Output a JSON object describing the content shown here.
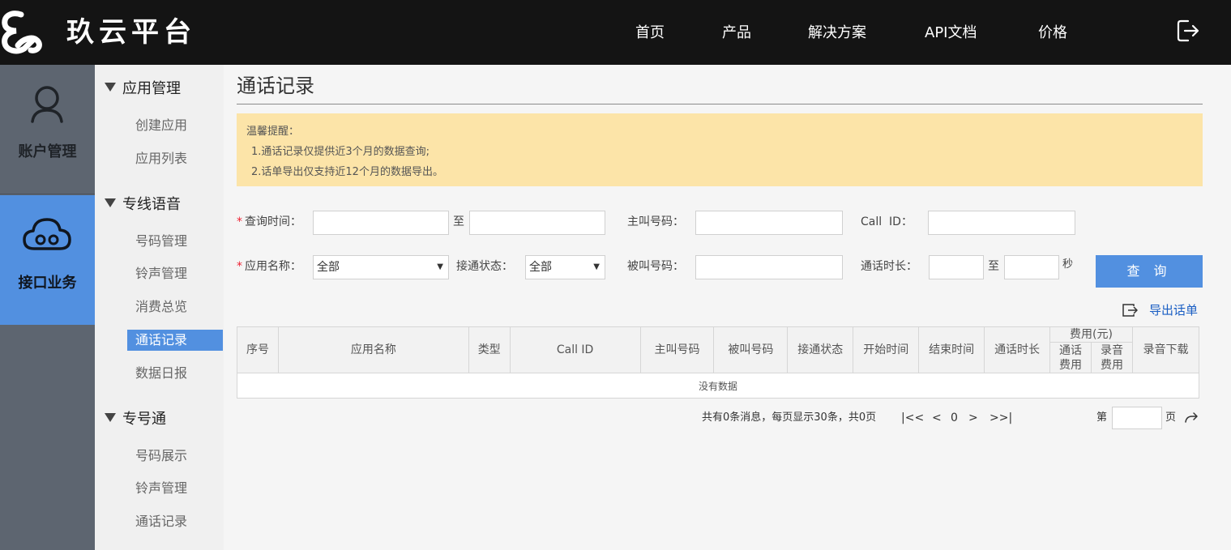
{
  "header": {
    "brand": "玖云平台",
    "nav": [
      "首页",
      "产品",
      "解决方案",
      "API文档",
      "价格"
    ]
  },
  "sidebar_main": {
    "account": "账户管理",
    "api": "接口业务"
  },
  "sidebar_sub": {
    "groups": [
      {
        "title": "应用管理",
        "items": [
          "创建应用",
          "应用列表"
        ]
      },
      {
        "title": "专线语音",
        "items": [
          "号码管理",
          "铃声管理",
          "消费总览",
          "通话记录",
          "数据日报"
        ]
      },
      {
        "title": "专号通",
        "items": [
          "号码展示",
          "铃声管理",
          "通话记录"
        ]
      }
    ],
    "active_item": "通话记录"
  },
  "main": {
    "title": "通话记录",
    "notice": {
      "heading": "温馨提醒：",
      "lines": [
        "1.通话记录仅提供近3个月的数据查询;",
        "2.话单导出仅支持近12个月的数据导出。"
      ]
    },
    "form": {
      "query_time_label": "查询时间：",
      "to_label": "至",
      "caller_label": "主叫号码：",
      "callid_label": "Call  ID：",
      "app_name_label": "应用名称：",
      "app_name_value": "全部",
      "connect_status_label": "接通状态：",
      "connect_status_value": "全部",
      "callee_label": "被叫号码：",
      "duration_label": "通话时长：",
      "duration_to": "至",
      "seconds_unit": "秒",
      "query_button": "查 询"
    },
    "export_label": "导出话单",
    "table": {
      "headers": [
        "序号",
        "应用名称",
        "类型",
        "Call ID",
        "主叫号码",
        "被叫号码",
        "接通状态",
        "开始时间",
        "结束时间",
        "通话时长",
        "费用(元)",
        "录音下载"
      ],
      "fee_sub": [
        "通话费用",
        "录音费用"
      ],
      "empty_text": "没有数据"
    },
    "pagination": {
      "info": "共有0条消息，每页显示30条，共0页",
      "first": "|<<",
      "prev": "<",
      "current": "0",
      "next": ">",
      "last": ">>|",
      "page_prefix": "第",
      "page_suffix": "页"
    }
  },
  "colors": {
    "topbar": "#141414",
    "accent_blue": "#5290e0",
    "notice_bg": "#fce4a8",
    "sidebar_gray": "#5d6570"
  }
}
